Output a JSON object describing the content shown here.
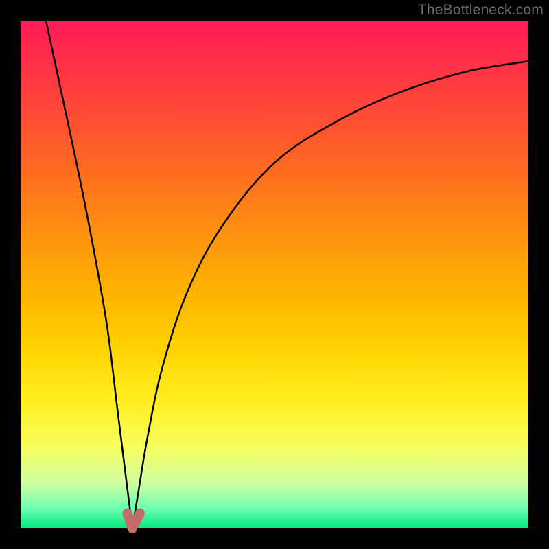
{
  "watermark": {
    "text": "TheBottleneck.com"
  },
  "colors": {
    "frame": "#000000",
    "curve": "#000000",
    "cusp_highlight": "#c46b6b",
    "gradient_stops": [
      "#ff1a58",
      "#ff2f48",
      "#ff4a35",
      "#ff6d20",
      "#ff9210",
      "#ffb700",
      "#ffd400",
      "#ffee20",
      "#f7ff60",
      "#d0ffa0",
      "#70ffb0",
      "#00e880"
    ]
  },
  "chart_data": {
    "type": "line",
    "title": "",
    "xlabel": "",
    "ylabel": "",
    "xlim": [
      0,
      100
    ],
    "ylim": [
      0,
      100
    ],
    "note": "V-shaped bottleneck curve; y is percentage of bottleneck (0 = green/optimal at bottom, 100 = red/severe at top). Cusp minimum near x≈22. Left branch falls steeply from top-left; right branch rises asymptotically toward top-right.",
    "series": [
      {
        "name": "left-branch",
        "x": [
          5,
          8,
          11,
          14,
          17,
          19,
          20.5,
          21.5,
          22
        ],
        "y": [
          100,
          86,
          72,
          57,
          40,
          24,
          12,
          4,
          0
        ]
      },
      {
        "name": "right-branch",
        "x": [
          22,
          23,
          25,
          28,
          33,
          40,
          50,
          62,
          75,
          88,
          100
        ],
        "y": [
          0,
          6,
          18,
          32,
          47,
          60,
          72,
          80,
          86,
          90,
          92
        ]
      }
    ],
    "highlight": {
      "name": "cusp",
      "x": [
        21,
        22,
        23.5
      ],
      "y": [
        3,
        0,
        3
      ]
    }
  }
}
